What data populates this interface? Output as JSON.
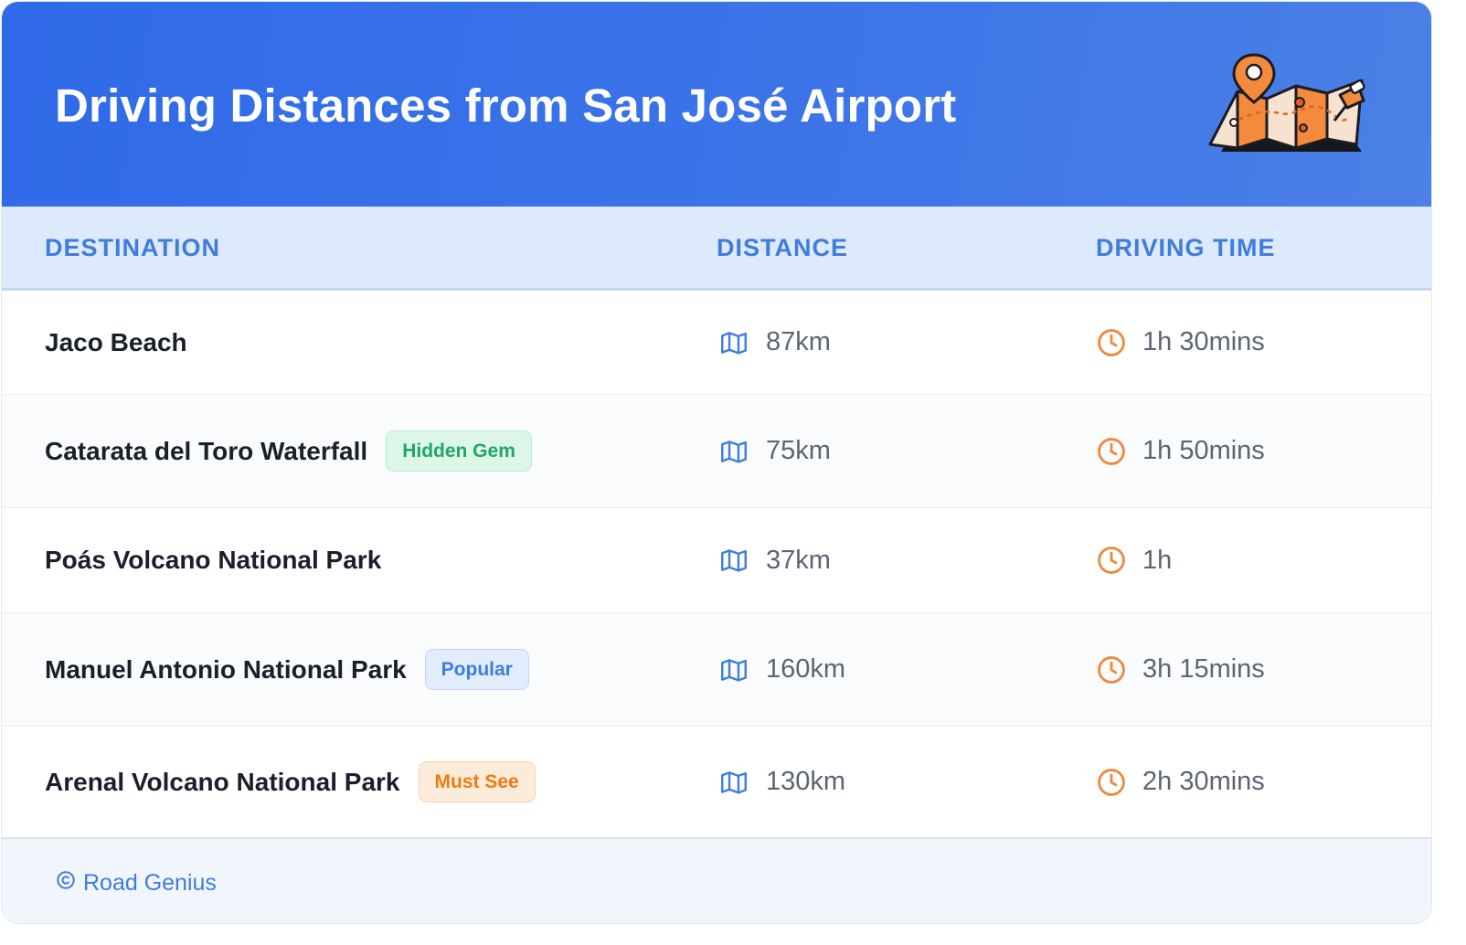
{
  "header": {
    "title": "Driving Distances from San José Airport",
    "illustration_icon": "map-pin-illustration"
  },
  "columns": [
    "DESTINATION",
    "DISTANCE",
    "DRIVING TIME"
  ],
  "rows": [
    {
      "destination": "Jaco Beach",
      "badge": null,
      "distance": "87km",
      "time": "1h 30mins"
    },
    {
      "destination": "Catarata del Toro Waterfall",
      "badge": "Hidden Gem",
      "badge_color": "#21a568",
      "distance": "75km",
      "time": "1h 50mins"
    },
    {
      "destination": "Poás Volcano National Park",
      "badge": null,
      "distance": "37km",
      "time": "1h"
    },
    {
      "destination": "Manuel Antonio National Park",
      "badge": "Popular",
      "badge_color": "#3f7ddb",
      "distance": "160km",
      "time": "3h 15mins"
    },
    {
      "destination": "Arenal Volcano National Park",
      "badge": "Must See",
      "badge_color": "#ee7a14",
      "distance": "130km",
      "time": "2h 30mins"
    }
  ],
  "icons": {
    "distance": "map-icon",
    "time": "clock-icon",
    "credit": "copyright-icon"
  },
  "footer": {
    "credit": "Road Genius"
  },
  "colors": {
    "header_bg": "#2f6ae8",
    "accent": "#3f7ddb",
    "clock": "#f0883e"
  }
}
